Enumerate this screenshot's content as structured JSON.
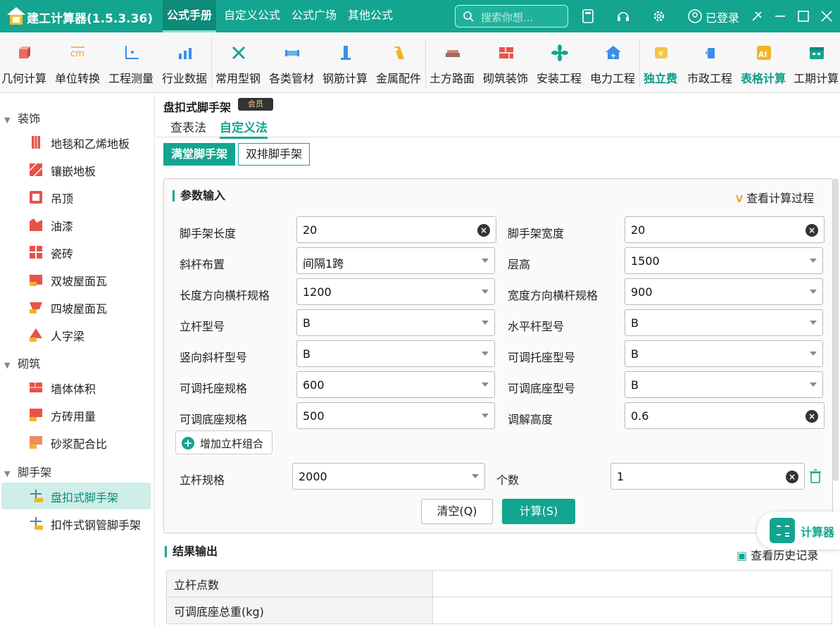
{
  "app": {
    "title": "建工计算器(1.5.3.36)",
    "nav": [
      "公式手册",
      "自定义公式",
      "公式广场",
      "其他公式"
    ],
    "search_placeholder": "搜索你想...",
    "login": "已登录"
  },
  "ribbon": [
    {
      "label": "几何计算",
      "icon": "cube-icon"
    },
    {
      "label": "单位转换",
      "icon": "cm-convert-icon"
    },
    {
      "label": "工程测量",
      "icon": "axis-icon"
    },
    {
      "label": "行业数据",
      "icon": "bar-chart-icon"
    },
    {
      "label": "常用型钢",
      "icon": "tools-icon"
    },
    {
      "label": "各类管材",
      "icon": "pipe-icon"
    },
    {
      "label": "钢筋计算",
      "icon": "rebar-icon"
    },
    {
      "label": "金属配件",
      "icon": "metal-icon"
    },
    {
      "label": "土方路面",
      "icon": "road-icon"
    },
    {
      "label": "砌筑装饰",
      "icon": "brick-icon"
    },
    {
      "label": "安装工程",
      "icon": "fan-icon"
    },
    {
      "label": "电力工程",
      "icon": "power-house-icon"
    },
    {
      "label": "独立费",
      "icon": "coins-icon"
    },
    {
      "label": "市政工程",
      "icon": "hydrant-icon"
    },
    {
      "label": "表格计算",
      "icon": "vip-ai-icon"
    },
    {
      "label": "工期计算",
      "icon": "calendar-icon"
    }
  ],
  "sidebar": {
    "groups": [
      {
        "label": "装饰",
        "items": [
          "地毯和乙烯地板",
          "镶嵌地板",
          "吊顶",
          "油漆",
          "瓷砖",
          "双坡屋面瓦",
          "四坡屋面瓦",
          "人字梁"
        ]
      },
      {
        "label": "砌筑",
        "items": [
          "墙体体积",
          "方砖用量",
          "砂浆配合比"
        ]
      },
      {
        "label": "脚手架",
        "items": [
          "盘扣式脚手架",
          "扣件式钢管脚手架"
        ]
      }
    ],
    "selected": "盘扣式脚手架"
  },
  "page": {
    "title": "盘扣式脚手架",
    "vip_badge": "会员",
    "tabs": [
      "查表法",
      "自定义法"
    ],
    "active_tab": "自定义法",
    "segments": [
      "满堂脚手架",
      "双排脚手架"
    ],
    "input_section": "参数输入",
    "view_process": "查看计算过程",
    "fields": [
      {
        "label": "脚手架长度",
        "value": "20",
        "kind": "clear"
      },
      {
        "label": "脚手架宽度",
        "value": "20",
        "kind": "clear"
      },
      {
        "label": "斜杆布置",
        "value": "间隔1跨",
        "kind": "select"
      },
      {
        "label": "层高",
        "value": "1500",
        "kind": "select"
      },
      {
        "label": "长度方向横杆规格",
        "value": "1200",
        "kind": "select"
      },
      {
        "label": "宽度方向横杆规格",
        "value": "900",
        "kind": "select"
      },
      {
        "label": "立杆型号",
        "value": "B",
        "kind": "select"
      },
      {
        "label": "水平杆型号",
        "value": "B",
        "kind": "select"
      },
      {
        "label": "竖向斜杆型号",
        "value": "B",
        "kind": "select"
      },
      {
        "label": "可调托座型号",
        "value": "B",
        "kind": "select"
      },
      {
        "label": "可调托座规格",
        "value": "600",
        "kind": "select"
      },
      {
        "label": "可调底座型号",
        "value": "B",
        "kind": "select"
      },
      {
        "label": "可调底座规格",
        "value": "500",
        "kind": "select"
      },
      {
        "label": "调解高度",
        "value": "0.6",
        "kind": "clear"
      }
    ],
    "add_button": "增加立杆组合",
    "pole_spec_label": "立杆规格",
    "pole_spec_value": "2000",
    "count_label": "个数",
    "count_value": "1",
    "clear_button": "清空(Q)",
    "calc_button": "计算(S)",
    "float_calc": "计算器",
    "result_section": "结果输出",
    "history": "查看历史记录",
    "results": [
      "立杆点数",
      "可调底座总重(kg)"
    ]
  }
}
